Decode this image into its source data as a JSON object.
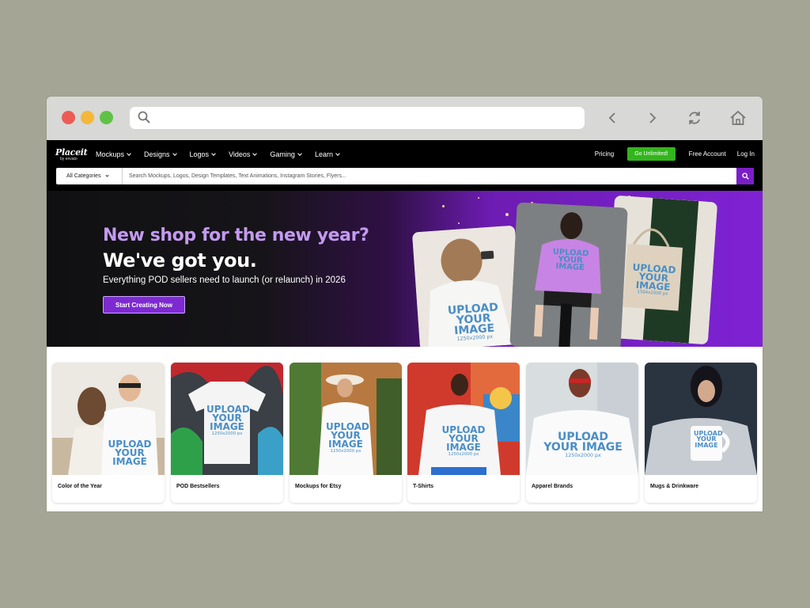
{
  "colors": {
    "page_bg": "#a4a594",
    "accent": "#7e2ad1",
    "go_green": "#33b51d",
    "nav_bg": "#000000"
  },
  "browser": {
    "back_icon": "chevron-left-icon",
    "forward_icon": "chevron-right-icon",
    "refresh_icon": "refresh-icon",
    "home_icon": "home-icon",
    "search_icon": "search-icon"
  },
  "nav": {
    "logo": {
      "name": "Placeit",
      "sub": "by envato"
    },
    "menu": [
      {
        "label": "Mockups"
      },
      {
        "label": "Designs"
      },
      {
        "label": "Logos"
      },
      {
        "label": "Videos"
      },
      {
        "label": "Gaming"
      },
      {
        "label": "Learn"
      }
    ],
    "pricing": "Pricing",
    "go_unlimited": "Go Unlimited!",
    "free_account": "Free Account",
    "login": "Log In"
  },
  "search": {
    "category": "All Categories",
    "placeholder": "Search Mockups, Logos, Design Templates, Text Animations, Instagram Stories, Flyers..."
  },
  "hero": {
    "title_line1": "New shop for the new year?",
    "title_line2": "We've got you.",
    "subtitle": "Everything POD sellers need to launch (or relaunch) in 2026",
    "cta": "Start Creating Now",
    "print_a": "UPLOAD YOUR IMAGE",
    "print_a_dim": "1250x2000 px",
    "print_b": "UPLOAD YOUR IMAGE",
    "print_c": "UPLOAD YOUR IMAGE",
    "print_c_dim": "1584x2000 px"
  },
  "cards": [
    {
      "label": "Color of the Year",
      "print": "UPLOAD YOUR IMAGE"
    },
    {
      "label": "POD Bestsellers",
      "print": "UPLOAD YOUR IMAGE",
      "dim": "1250x2000 px"
    },
    {
      "label": "Mockups for Etsy",
      "print": "UPLOAD YOUR IMAGE",
      "dim": "1250x2000 px"
    },
    {
      "label": "T-Shirts",
      "print": "UPLOAD YOUR IMAGE",
      "dim": "1250x2000 px"
    },
    {
      "label": "Apparel Brands",
      "print": "UPLOAD YOUR IMAGE",
      "dim": "1250x2000 px"
    },
    {
      "label": "Mugs & Drinkware",
      "print": "UPLOAD YOUR IMAGE"
    }
  ]
}
